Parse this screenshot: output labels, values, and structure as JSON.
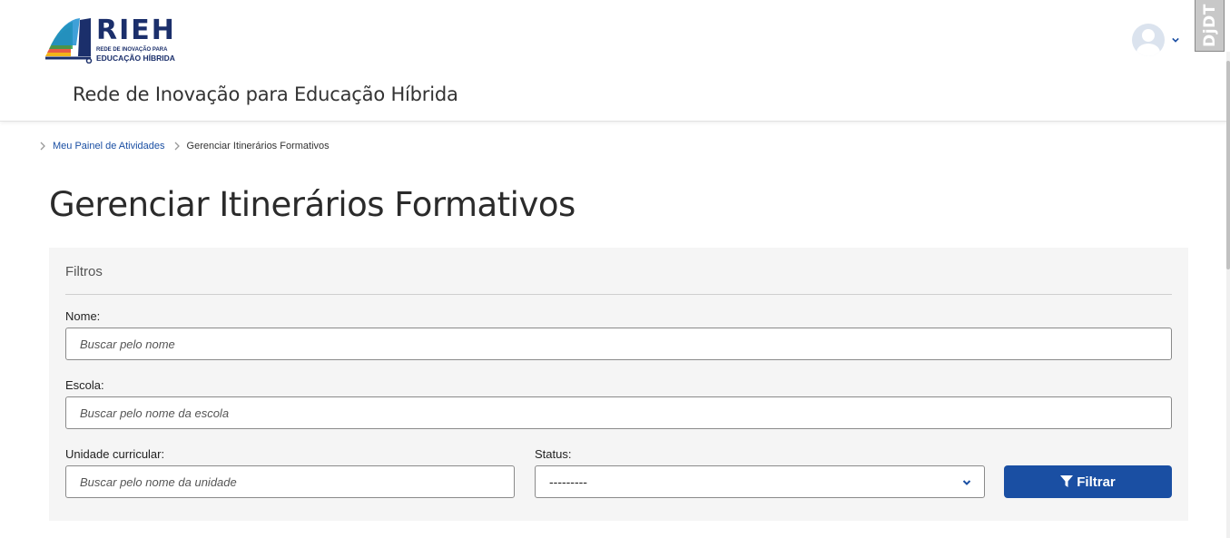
{
  "header": {
    "logo": {
      "title": "RIEH",
      "subtitle_line1": "REDE DE INOVAÇÃO PARA",
      "subtitle_line2": "EDUCAÇÃO HÍBRIDA"
    },
    "site_name": "Rede de Inovação para Educação Híbrida",
    "user_menu": {
      "avatar_icon": "user-avatar-icon",
      "caret_icon": "chevron-down-icon"
    },
    "debug_toolbar_label": "DjDT"
  },
  "breadcrumb": {
    "items": [
      {
        "label": "Meu Painel de Atividades"
      },
      {
        "label": "Gerenciar Itinerários Formativos"
      }
    ]
  },
  "page_title": "Gerenciar Itinerários Formativos",
  "filters": {
    "title": "Filtros",
    "nome": {
      "label": "Nome:",
      "placeholder": "Buscar pelo nome"
    },
    "escola": {
      "label": "Escola:",
      "placeholder": "Buscar pelo nome da escola"
    },
    "unidade": {
      "label": "Unidade curricular:",
      "placeholder": "Buscar pelo nome da unidade"
    },
    "status": {
      "label": "Status:",
      "selected": "---------"
    },
    "submit_label": "Filtrar"
  },
  "colors": {
    "primary": "#1a4fa3",
    "logo_navy": "#1b2f6b",
    "panel_bg": "#f5f5f5"
  }
}
